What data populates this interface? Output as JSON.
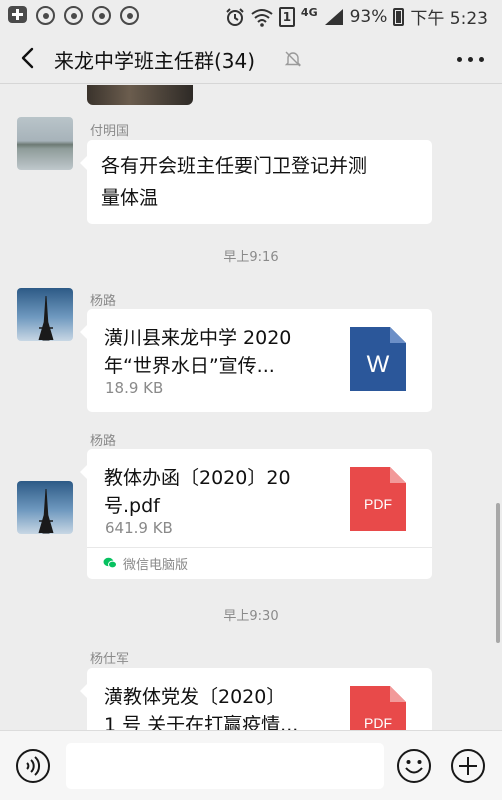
{
  "status_bar": {
    "icons": [
      "add-icon",
      "qq-icon",
      "qq-icon",
      "qq-icon",
      "qq-icon",
      "alarm-icon",
      "wifi-icon",
      "sim-icon",
      "signal-icon",
      "battery-icon"
    ],
    "sim_label": "1",
    "network": "4G",
    "battery": "93%",
    "time": "下午 5:23"
  },
  "header": {
    "title": "来龙中学班主任群(34)"
  },
  "chat": {
    "messages": [
      {
        "sender": "付明国",
        "type": "text",
        "text_line1": "各有开会班主任要门卫登记并测",
        "text_line2": "量体温"
      },
      {
        "sender": "杨路",
        "type": "file",
        "name_line1": "潢川县来龙中学 2020",
        "name_line2": "年“世界水日”宣传...",
        "size": "18.9 KB",
        "icon": "W"
      },
      {
        "sender": "杨路",
        "type": "file",
        "name_line1": "教体办函〔2020〕20",
        "name_line2": "号.pdf",
        "size": "641.9 KB",
        "icon": "PDF",
        "source": "微信电脑版"
      },
      {
        "sender": "杨仕军",
        "type": "file",
        "name_line1": "潢教体党发〔2020〕",
        "name_line2": "1 号 关于在打赢疫情...",
        "icon": "PDF"
      }
    ],
    "timestamps": [
      "早上9:16",
      "早上9:30"
    ]
  },
  "input_bar": {
    "value": ""
  },
  "colors": {
    "background": "#ededed",
    "bubble": "#ffffff",
    "word_blue": "#2b579a",
    "pdf_red": "#e84a4a",
    "wechat_green": "#07c160"
  }
}
